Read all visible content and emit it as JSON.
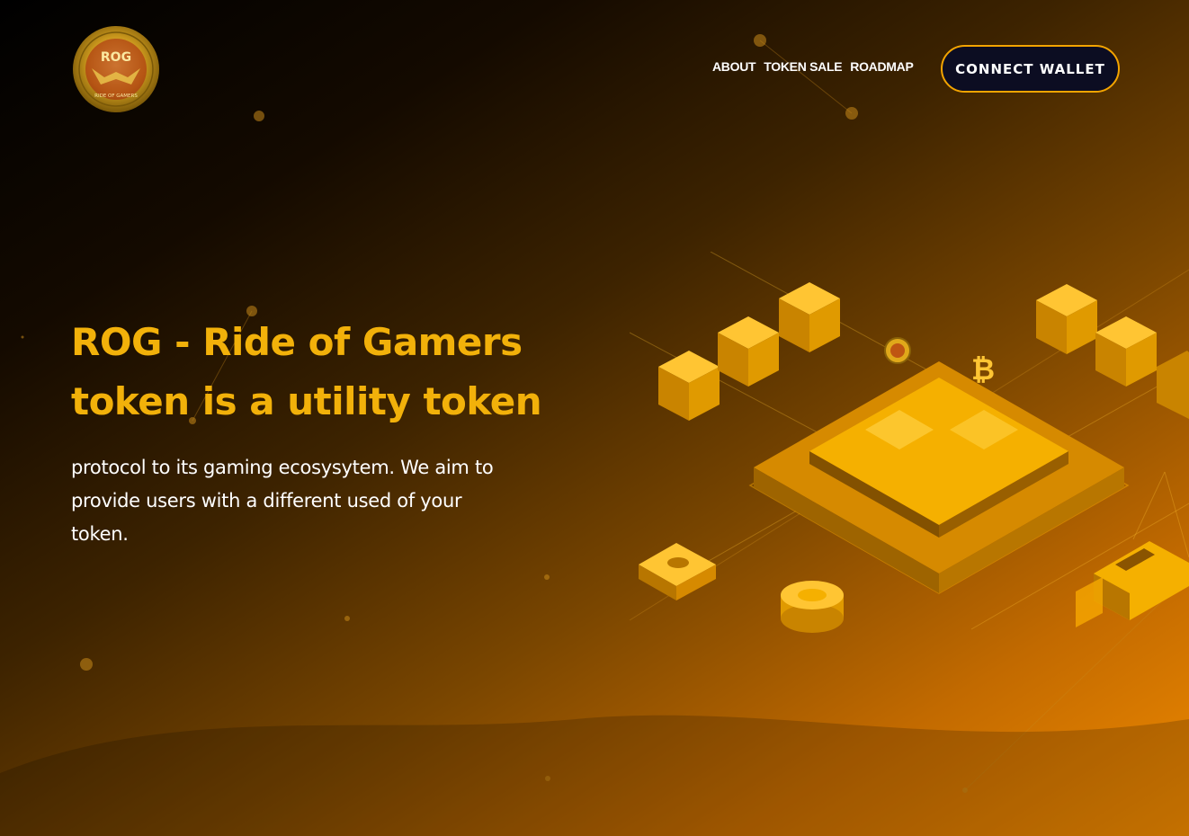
{
  "logo": {
    "text": "ROG",
    "ring_text": "RIDE OF GAMERS"
  },
  "nav": {
    "items": [
      {
        "label": "ABOUT"
      },
      {
        "label": "TOKEN SALE"
      },
      {
        "label": "ROADMAP"
      }
    ]
  },
  "header": {
    "connect_label": "CONNECT WALLET"
  },
  "hero": {
    "title_line1": "ROG - Ride of Gamers",
    "title_line2": "token is a utility token",
    "body_line1": "protocol to its gaming ecosysytem. We aim to",
    "body_line2": "provide users with a different used of your",
    "body_line3": "token."
  },
  "icons": {
    "bitcoin_glyph": "₿"
  },
  "colors": {
    "accent": "#f2b10a",
    "button_bg": "#0c0d22",
    "button_border": "#f3a400"
  }
}
